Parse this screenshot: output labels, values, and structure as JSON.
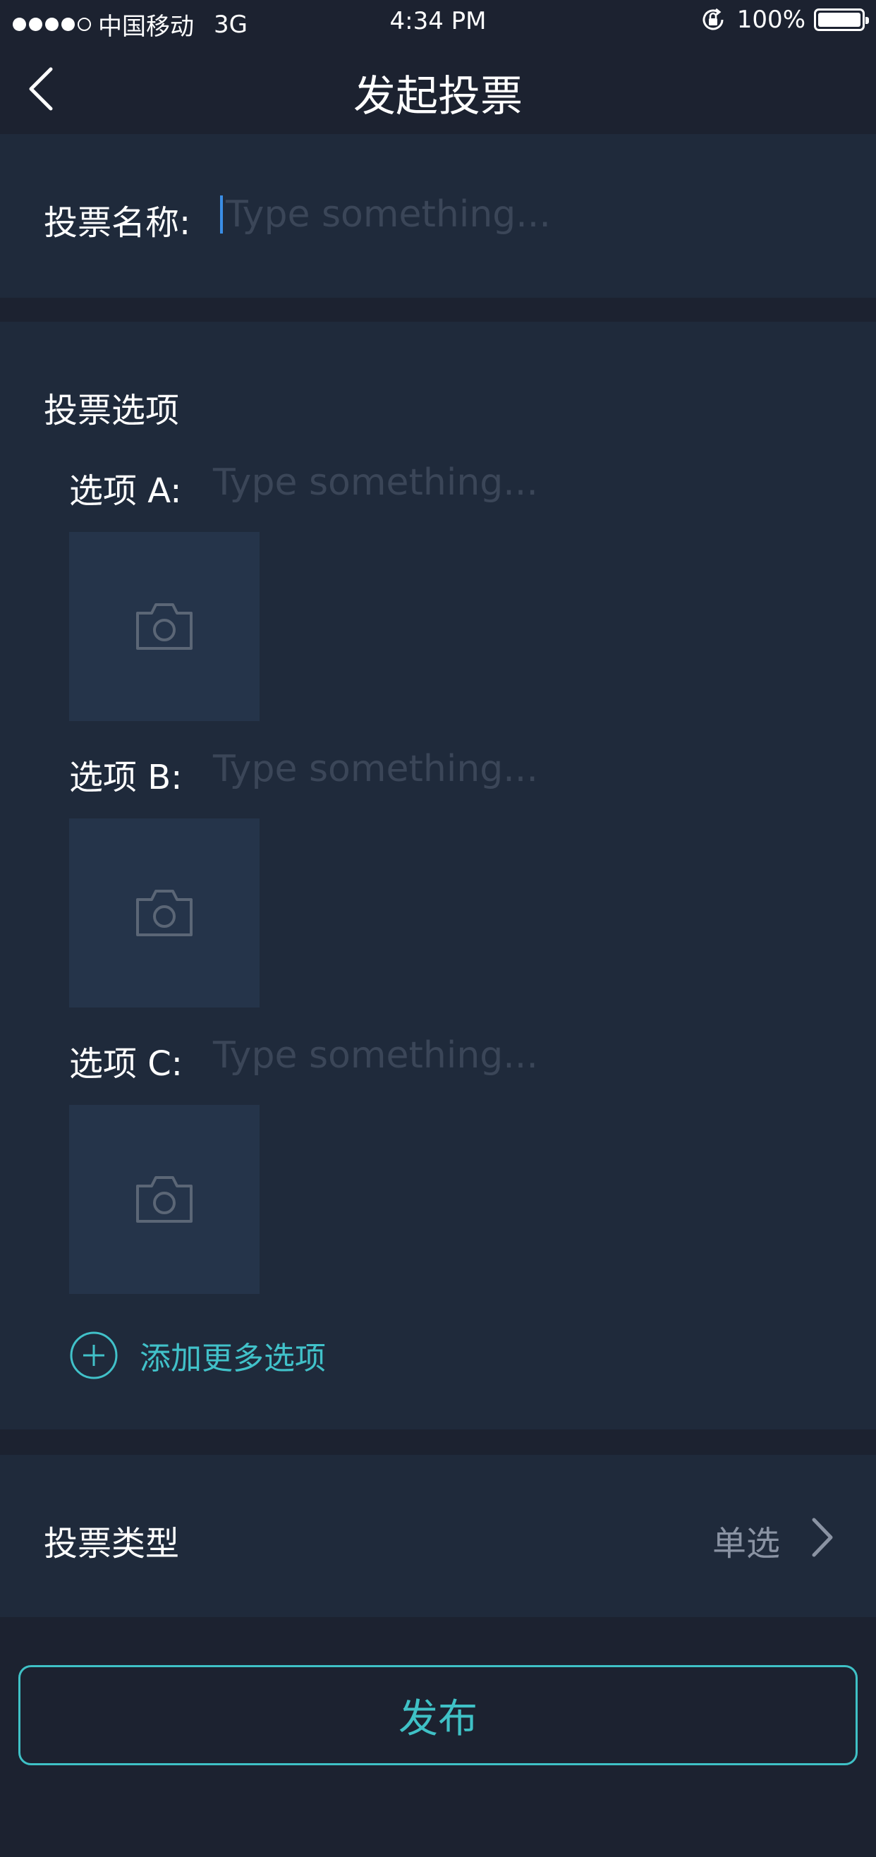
{
  "status_bar": {
    "carrier": "中国移动",
    "network": "3G",
    "time": "4:34 PM",
    "battery": "100%",
    "battery_level": 1.0,
    "signal_bars_filled": 4,
    "signal_bars_total": 5
  },
  "nav": {
    "title": "发起投票",
    "back_icon": "chevron-left-icon"
  },
  "vote_name": {
    "label": "投票名称:",
    "placeholder": "Type something..."
  },
  "options_section": {
    "title": "投票选项",
    "options": [
      {
        "label": "选项 A:",
        "placeholder": "Type something...",
        "photo_icon": "camera-icon"
      },
      {
        "label": "选项 B:",
        "placeholder": "Type something...",
        "photo_icon": "camera-icon"
      },
      {
        "label": "选项 C:",
        "placeholder": "Type something...",
        "photo_icon": "camera-icon"
      }
    ],
    "add_more_label": "添加更多选项",
    "add_icon": "plus-circle-icon"
  },
  "vote_type": {
    "label": "投票类型",
    "value": "单选",
    "icon": "chevron-right-icon"
  },
  "publish": {
    "label": "发布"
  },
  "colors": {
    "background": "#1c2230",
    "card": "#1f2a3b",
    "photo_box": "#25344a",
    "accent": "#3fc1c6",
    "placeholder": "#3b4658",
    "muted_text": "#8a93a3"
  }
}
